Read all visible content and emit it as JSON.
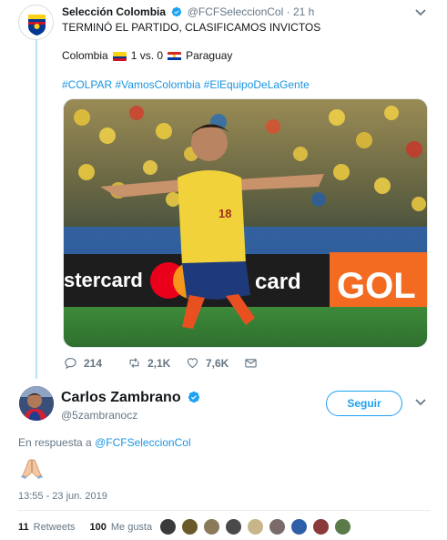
{
  "parent_tweet": {
    "author_name": "Selección Colombia",
    "author_handle": "@FCFSeleccionCol",
    "time_sep": "·",
    "time": "21 h",
    "text": "TERMINÓ EL PARTIDO, CLASIFICAMOS INVICTOS",
    "score": {
      "team_home": "Colombia",
      "result": "1 vs. 0",
      "team_away": "Paraguay"
    },
    "hashtags": [
      "#COLPAR",
      "#VamosColombia",
      "#ElEquipoDeLaGente"
    ],
    "media": {
      "ad_left": "stercard",
      "ad_mid": "card",
      "ad_right": "GOL",
      "player_number": "18"
    },
    "actions": {
      "replies": "214",
      "retweets": "2,1K",
      "likes": "7,6K"
    }
  },
  "reply_tweet": {
    "author_name": "Carlos Zambrano",
    "author_handle": "@5zambranocz",
    "follow_label": "Seguir",
    "reply_prefix": "En respuesta a",
    "reply_mention": "@FCFSeleccionCol",
    "emoji": "folded-hands",
    "timestamp": "13:55 - 23 jun. 2019",
    "retweet_count": "11",
    "retweet_label": "Retweets",
    "like_count": "100",
    "like_label": "Me gusta"
  },
  "colors": {
    "accent": "#1da1f2",
    "thread_line": "#b9e1f7",
    "muted": "#657786",
    "link": "#1b95e0"
  }
}
